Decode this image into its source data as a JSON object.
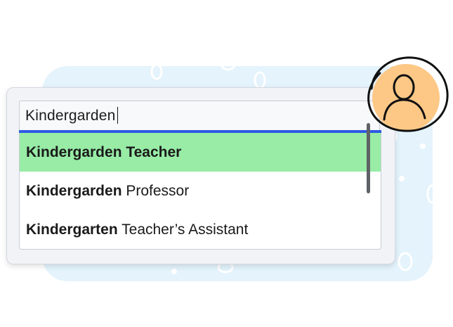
{
  "search": {
    "value": "Kindergarden"
  },
  "suggestions": [
    {
      "bold": "Kindergarden Teacher",
      "rest": "",
      "selected": true
    },
    {
      "bold": "Kindergarden",
      "rest": " Professor",
      "selected": false
    },
    {
      "bold": "Kindergarten",
      "rest": " Teacher’s Assistant",
      "selected": false
    }
  ],
  "icons": {
    "avatar": "user-avatar-icon"
  },
  "colors": {
    "focus_underline": "#2d5be3",
    "selected_option": "#98eca6",
    "avatar_fill": "#fdc886",
    "background_panel": "#e4f3fc"
  }
}
